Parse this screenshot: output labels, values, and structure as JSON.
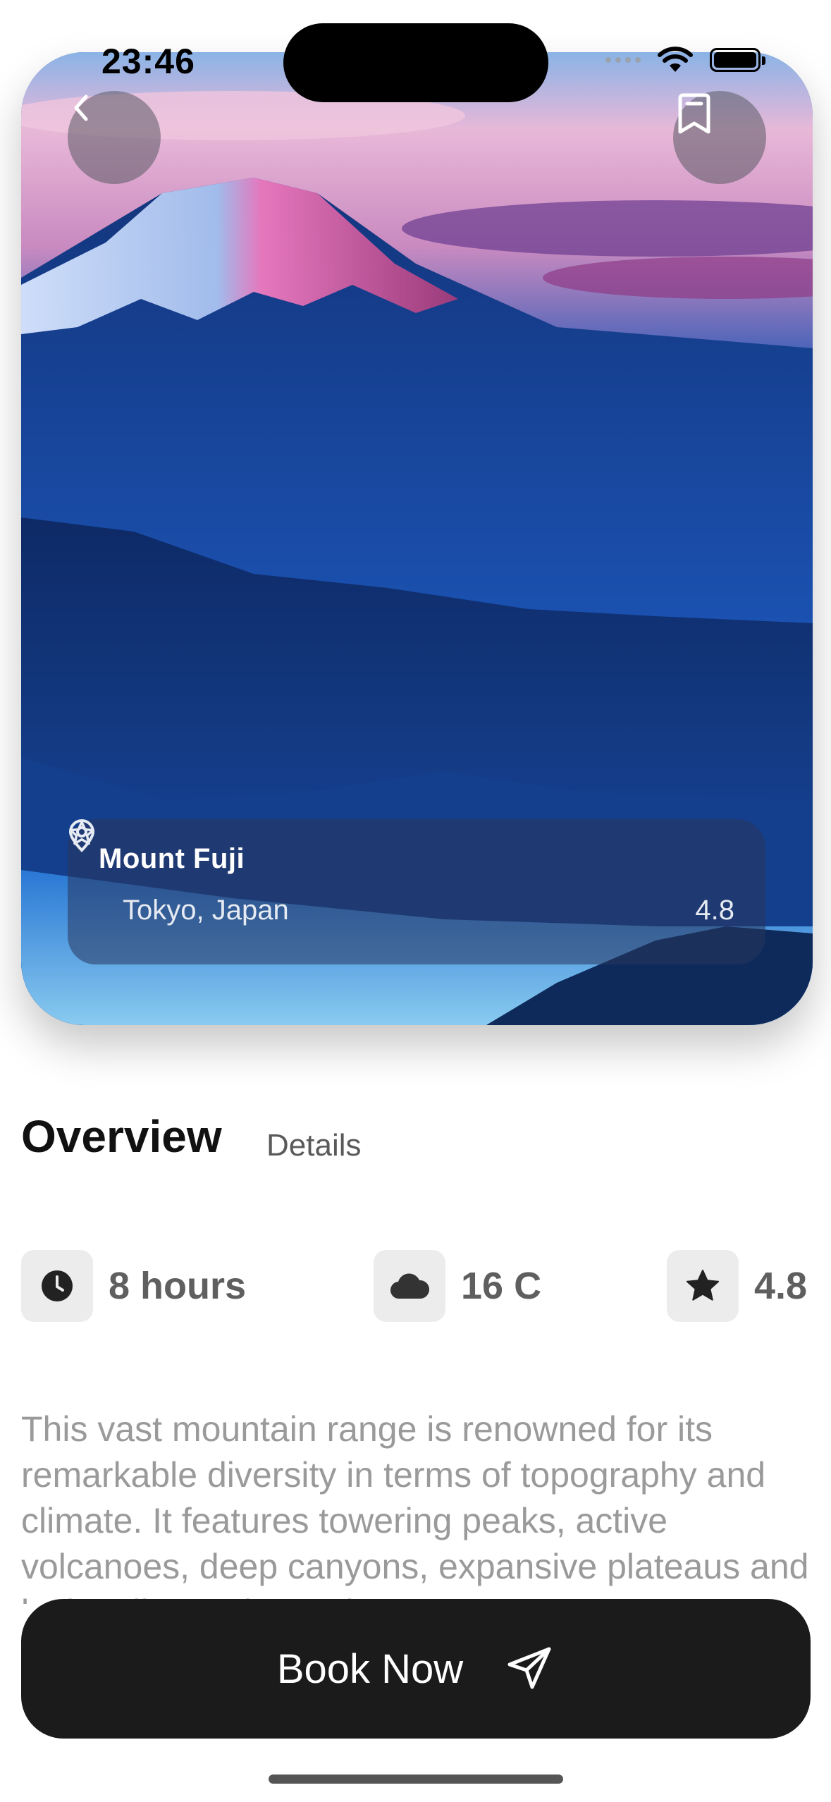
{
  "status_bar": {
    "time": "23:46"
  },
  "hero": {
    "title": "Mount Fuji",
    "location": "Tokyo, Japan",
    "rating": "4.8"
  },
  "tabs": [
    {
      "label": "Overview",
      "active": true
    },
    {
      "label": "Details",
      "active": false
    }
  ],
  "stats": [
    {
      "icon": "clock-icon",
      "label": "8 hours"
    },
    {
      "icon": "cloud-icon",
      "label": "16 C"
    },
    {
      "icon": "star-icon",
      "label": "4.8"
    }
  ],
  "description": "This vast mountain range is renowned for its remarkable diversity in terms of topography and climate. It features towering peaks, active volcanoes, deep canyons, expansive plateaus and lush valleys. The Andes",
  "book_button": {
    "label": "Book Now",
    "icon": "send-icon"
  }
}
